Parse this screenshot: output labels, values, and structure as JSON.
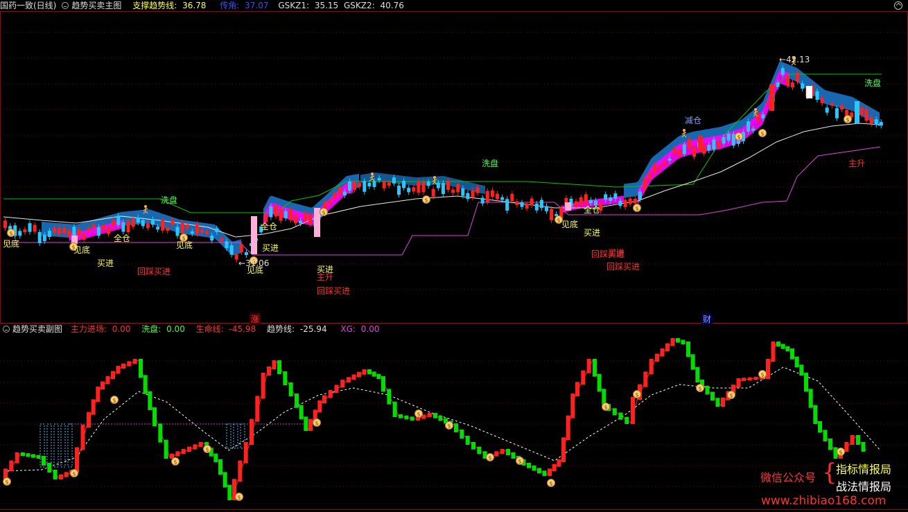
{
  "main_header": {
    "instrument": "国药一致(日线)",
    "indicator": "趋势买卖主图",
    "support_label": "支撑趋势线: ",
    "support_value": "36.78",
    "pressure_label": "传角: ",
    "pressure_value": "37.07",
    "gskz1_label": "GSKZ1: ",
    "gskz1_value": "35.15",
    "gskz2_label": "GSKZ2: ",
    "gskz2_value": "40.76"
  },
  "sub_header": {
    "indicator": "趋势买卖副图",
    "main_force_label": "主力进场: ",
    "main_force_value": "0.00",
    "wash_label": "洗盘: ",
    "wash_value": "0.00",
    "life_label": "生命线: ",
    "life_value": "-45.98",
    "trend_label": "趋势线: ",
    "trend_value": "-25.94",
    "xg_label": "XG: ",
    "xg_value": "0.00"
  },
  "price_labels": {
    "high": "42.13",
    "low": "31.06"
  },
  "date_markers": {
    "zhang": "涨",
    "cai": "财"
  },
  "signals": {
    "jiandi": "见底",
    "mairu": "买进",
    "quancang": "全仓",
    "huicai": "回踩买进",
    "xipan": "洗盘",
    "zhusheng": "主升",
    "jiancang": "减仓"
  },
  "watermark": {
    "account_label": "微信公众号",
    "line1": "指标情报局",
    "line2": "战法情报局",
    "url": "www.zhibiao168.com"
  },
  "colors": {
    "up": "#ff2020",
    "down": "#28c8ff",
    "sub_up": "#ff2020",
    "sub_down": "#00dd00",
    "support": "#00c800",
    "pressure": "#e040e0",
    "ribbon_blue": "#1c7ad0",
    "ribbon_pink": "#ff00ff",
    "white_line": "#e8e8e8",
    "signal_yellow": "#ffff40",
    "signal_red": "#ff3030",
    "signal_green": "#40ff40",
    "signal_blue": "#80a0ff",
    "gridline": "#7a0000"
  }
}
